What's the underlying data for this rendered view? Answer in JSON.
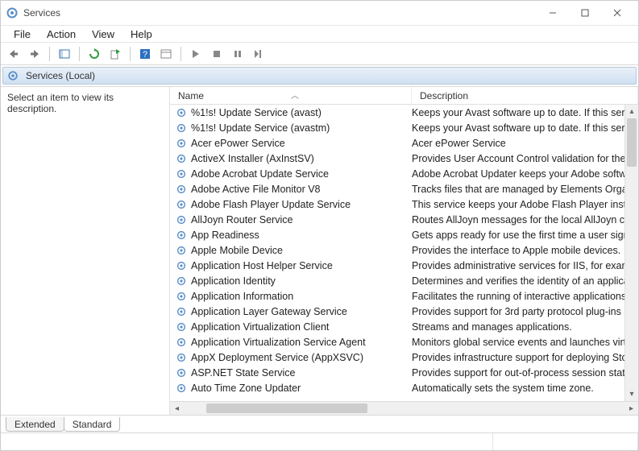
{
  "window": {
    "title": "Services"
  },
  "menubar": [
    "File",
    "Action",
    "View",
    "Help"
  ],
  "header": {
    "label": "Services (Local)"
  },
  "leftpane": {
    "hint": "Select an item to view its description."
  },
  "columns": {
    "name": "Name",
    "description": "Description"
  },
  "services": [
    {
      "name": "%1!s! Update Service (avast)",
      "desc": "Keeps your Avast software up to date. If this serv"
    },
    {
      "name": "%1!s! Update Service (avastm)",
      "desc": "Keeps your Avast software up to date. If this serv"
    },
    {
      "name": "Acer ePower Service",
      "desc": "Acer ePower Service"
    },
    {
      "name": "ActiveX Installer (AxInstSV)",
      "desc": "Provides User Account Control validation for the"
    },
    {
      "name": "Adobe Acrobat Update Service",
      "desc": "Adobe Acrobat Updater keeps your Adobe softw"
    },
    {
      "name": "Adobe Active File Monitor V8",
      "desc": "Tracks files that are managed by Elements Organ"
    },
    {
      "name": "Adobe Flash Player Update Service",
      "desc": "This service keeps your Adobe Flash Player insta"
    },
    {
      "name": "AllJoyn Router Service",
      "desc": "Routes AllJoyn messages for the local AllJoyn cli"
    },
    {
      "name": "App Readiness",
      "desc": "Gets apps ready for use the first time a user signs"
    },
    {
      "name": "Apple Mobile Device",
      "desc": "Provides the interface to Apple mobile devices."
    },
    {
      "name": "Application Host Helper Service",
      "desc": "Provides administrative services for IIS, for exam"
    },
    {
      "name": "Application Identity",
      "desc": "Determines and verifies the identity of an applica"
    },
    {
      "name": "Application Information",
      "desc": "Facilitates the running of interactive applications"
    },
    {
      "name": "Application Layer Gateway Service",
      "desc": "Provides support for 3rd party protocol plug-ins"
    },
    {
      "name": "Application Virtualization Client",
      "desc": "Streams and manages applications."
    },
    {
      "name": "Application Virtualization Service Agent",
      "desc": "Monitors global service events and launches virt"
    },
    {
      "name": "AppX Deployment Service (AppXSVC)",
      "desc": "Provides infrastructure support for deploying Sto"
    },
    {
      "name": "ASP.NET State Service",
      "desc": "Provides support for out-of-process session stat"
    },
    {
      "name": "Auto Time Zone Updater",
      "desc": "Automatically sets the system time zone."
    }
  ],
  "tabs": {
    "extended": "Extended",
    "standard": "Standard"
  }
}
